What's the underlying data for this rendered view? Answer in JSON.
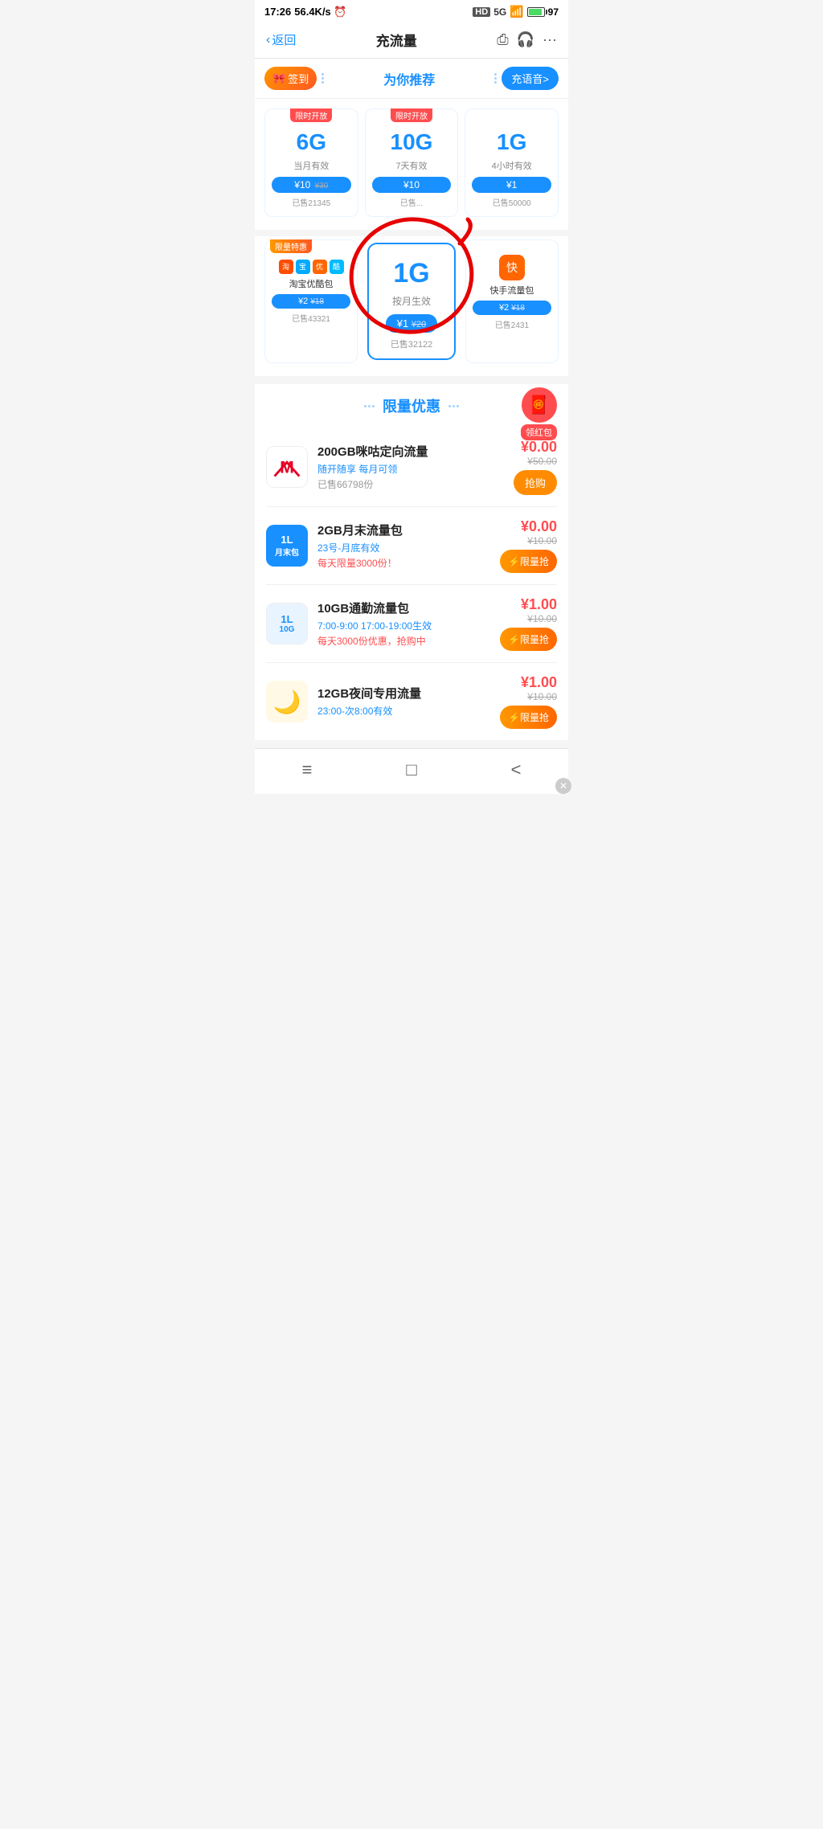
{
  "statusBar": {
    "time": "17:26",
    "speed": "56.4K/s",
    "alarm": "⏰",
    "hd": "HD",
    "signal": "5G",
    "battery": "97"
  },
  "navBar": {
    "backLabel": "返回",
    "title": "充流量",
    "shareIcon": "share",
    "headphoneIcon": "headphone",
    "moreIcon": "more"
  },
  "topBanner": {
    "checkinLabel": "签到",
    "recommendTitle": "为你推荐",
    "voiceLabel": "充语音>"
  },
  "packages": [
    {
      "size": "6G",
      "badge": "限时开放",
      "validity": "当月有效",
      "price": "¥10",
      "originalPrice": "¥30",
      "sold": "已售21345"
    },
    {
      "size": "10G",
      "badge": "限时开放",
      "validity": "7天有效",
      "price": "¥10",
      "originalPrice": "",
      "sold": "已售..."
    },
    {
      "size": "1G",
      "badge": "",
      "validity": "4小时有效",
      "price": "¥1",
      "originalPrice": "",
      "sold": "已售50000"
    }
  ],
  "specialPackages": {
    "left": {
      "badge": "限量特惠",
      "appIcons": [
        "淘",
        "宝",
        "优",
        "酷"
      ],
      "title": "淘宝优酷包",
      "price": "¥2",
      "originalPrice": "¥18",
      "sold": "已售43321"
    },
    "center": {
      "size": "1G",
      "validity": "按月生效",
      "price": "¥1",
      "originalPrice": "¥20",
      "sold": "已售32122"
    },
    "right": {
      "appIcon": "快",
      "title": "快手流量包",
      "price": "¥2",
      "originalPrice": "¥18",
      "sold": "已售2431"
    }
  },
  "limitedSection": {
    "title": "限量优惠",
    "redPacketLabel": "领红包",
    "offers": [
      {
        "id": "miqia",
        "iconText": "M",
        "iconBg": "#e8003a",
        "name": "200GB咪咕定向流量",
        "desc": "随开随享 每月可领",
        "sold": "已售66798份",
        "price": "¥0.00",
        "originalPrice": "¥50.00",
        "btnType": "buy",
        "btnLabel": "抢购"
      },
      {
        "id": "month",
        "iconText": "月末包",
        "iconTopText": "1L",
        "iconBg": "#1890ff",
        "name": "2GB月末流量包",
        "desc": "23号-月底有效",
        "warning": "每天限量3000份！",
        "sold": "",
        "price": "¥0.00",
        "originalPrice": "¥10.00",
        "btnType": "limit",
        "btnLabel": "⚡限量抢"
      },
      {
        "id": "commute",
        "iconText": "10G",
        "iconBg": "#e8f4ff",
        "name": "10GB通勤流量包",
        "desc": "7:00-9:00 17:00-19:00生效",
        "warning": "每天3000份优惠，抢购中",
        "sold": "",
        "price": "¥1.00",
        "originalPrice": "¥10.00",
        "btnType": "limit",
        "btnLabel": "⚡限量抢"
      },
      {
        "id": "night",
        "iconText": "🌙",
        "iconBg": "#fff9e6",
        "name": "12GB夜间专用流量",
        "desc": "23:00-次8:00有效",
        "sold": "",
        "price": "¥1.00",
        "originalPrice": "¥10.00",
        "btnType": "limit",
        "btnLabel": "⚡限量抢"
      }
    ]
  },
  "bottomNav": {
    "homeIcon": "≡",
    "squareIcon": "□",
    "backIcon": "<"
  }
}
